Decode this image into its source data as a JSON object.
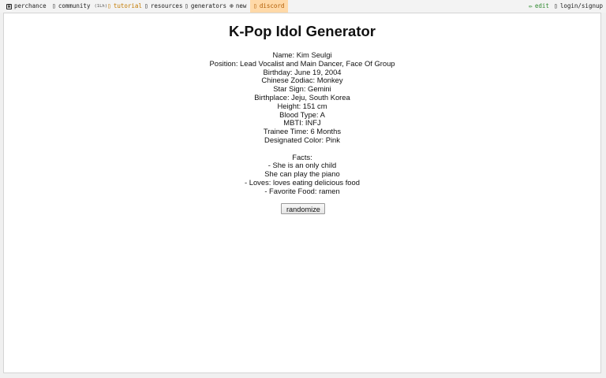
{
  "nav": {
    "perchance": "perchance",
    "community": "community",
    "community_count": "(1Lh)",
    "tutorial": "tutorial",
    "resources": "resources",
    "generators": "generators",
    "new": "new",
    "discord": "discord",
    "edit": "edit",
    "login": "login/signup"
  },
  "icons": {
    "perchance": "die-icon",
    "community": "community-icon",
    "tutorial": "tutorial-icon",
    "resources": "resources-icon",
    "generators": "generators-icon",
    "new": "plus-circle-icon",
    "discord": "discord-icon",
    "edit": "pencil-icon",
    "login": "user-icon"
  },
  "colors": {
    "tutorial": "#c27a00",
    "discord_bg": "#ffd9a8",
    "edit": "#2f8a2f"
  },
  "generator": {
    "title": "K-Pop Idol Generator",
    "lines": {
      "name": "Name: Kim Seulgi",
      "position": "Position: Lead Vocalist and Main Dancer, Face Of Group",
      "birthday": "Birthday: June 19, 2004",
      "zodiac": "Chinese Zodiac: Monkey",
      "star_sign": "Star Sign: Gemini",
      "birthplace": "Birthplace: Jeju, South Korea",
      "height": "Height: 151 cm",
      "blood_type": "Blood Type: A",
      "mbti": "MBTI: INFJ",
      "trainee_time": "Trainee Time: 6 Months",
      "color": "Designated Color: Pink"
    },
    "facts_heading": "Facts:",
    "facts": [
      "- She is an only child",
      "She can play the piano",
      "- Loves: loves eating delicious food",
      "- Favorite Food: ramen"
    ],
    "button_label": "randomize"
  }
}
